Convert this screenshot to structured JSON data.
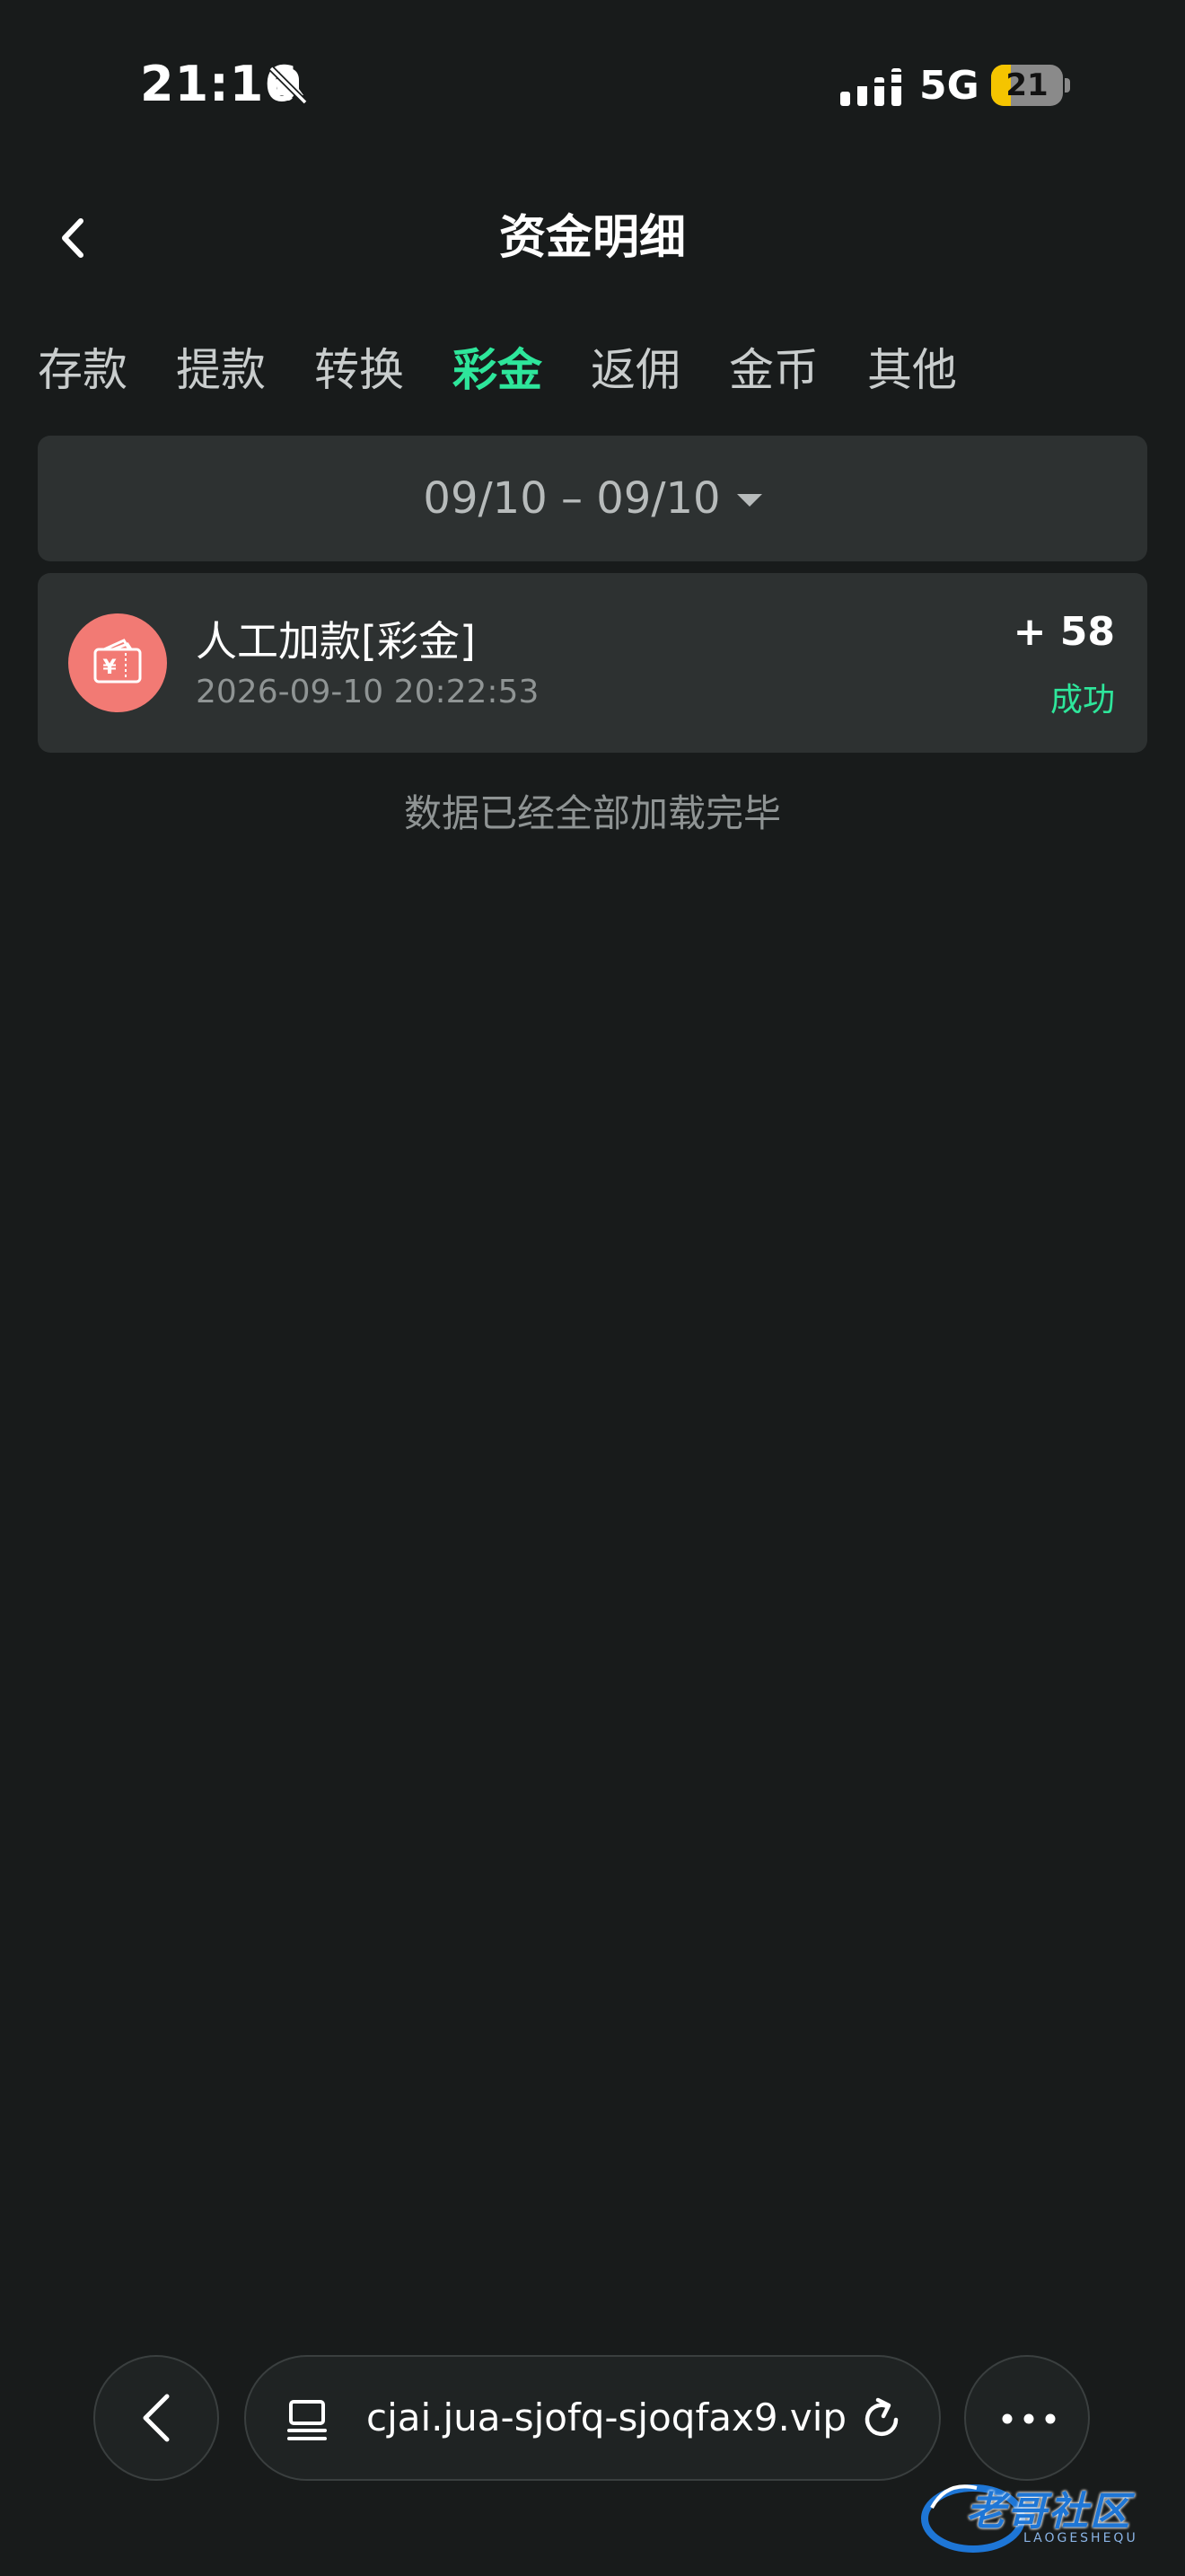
{
  "status_bar": {
    "time": "21:16",
    "network": "5G",
    "battery": 21,
    "icons": [
      "bell-muted-icon",
      "signal-icon",
      "battery-icon"
    ]
  },
  "header": {
    "title": "资金明细"
  },
  "tabs": [
    {
      "label": "存款",
      "active": false
    },
    {
      "label": "提款",
      "active": false
    },
    {
      "label": "转换",
      "active": false
    },
    {
      "label": "彩金",
      "active": true
    },
    {
      "label": "返佣",
      "active": false
    },
    {
      "label": "金币",
      "active": false
    },
    {
      "label": "其他",
      "active": false
    }
  ],
  "date_filter": {
    "range": "09/10 – 09/10"
  },
  "records": [
    {
      "title": "人工加款[彩金]",
      "time": "2026-09-10 20:22:53",
      "amount": "+ 58",
      "status": "成功",
      "icon": "wallet-yuan-icon"
    }
  ],
  "end_message": "数据已经全部加载完毕",
  "browser": {
    "url": "cjai.jua-sjofq-sjoqfax9.vip"
  },
  "watermark": {
    "text": "老哥社区",
    "sub": "LAOGESHEQU"
  },
  "colors": {
    "background": "#181b1b",
    "card": "#2d3131",
    "accent": "#2ee69b",
    "icon_bg": "#f27a74"
  }
}
